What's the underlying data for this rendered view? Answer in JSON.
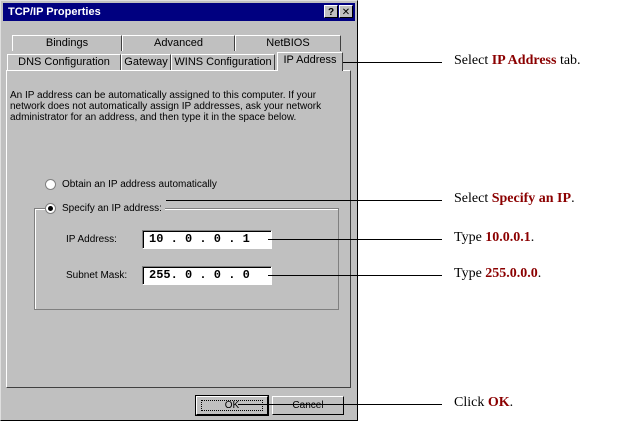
{
  "window": {
    "title": "TCP/IP Properties",
    "help_glyph": "?",
    "close_glyph": "✕"
  },
  "tabs": {
    "row1": [
      "Bindings",
      "Advanced",
      "NetBIOS"
    ],
    "row2": [
      "DNS Configuration",
      "Gateway",
      "WINS Configuration",
      "IP Address"
    ],
    "active": "IP Address"
  },
  "description": "An IP address can be automatically assigned to this computer. If your network does not automatically assign IP addresses, ask your network administrator for an address, and then type it in the space below.",
  "options": {
    "obtain_label": "Obtain an IP address automatically",
    "specify_label": "Specify an IP address:",
    "selected": "specify"
  },
  "fields": {
    "ip_label": "IP Address:",
    "ip_value": "10 . 0 . 0 . 1",
    "mask_label": "Subnet Mask:",
    "mask_value": "255. 0 . 0 . 0"
  },
  "buttons": {
    "ok": "OK",
    "cancel": "Cancel"
  },
  "callouts": {
    "tab": {
      "prefix": "Select ",
      "bold": "IP Address",
      "suffix": " tab."
    },
    "specify": {
      "prefix": "Select ",
      "bold": "Specify an IP",
      "suffix": "."
    },
    "ip": {
      "prefix": "Type ",
      "bold": "10.0.0.1",
      "suffix": "."
    },
    "mask": {
      "prefix": "Type ",
      "bold": "255.0.0.0",
      "suffix": "."
    },
    "ok": {
      "prefix": "Click ",
      "bold": "OK",
      "suffix": "."
    }
  },
  "colors": {
    "title_bar": "#000080",
    "dialog_face": "#c0c0c0",
    "callout_emphasis": "#8b0000"
  }
}
